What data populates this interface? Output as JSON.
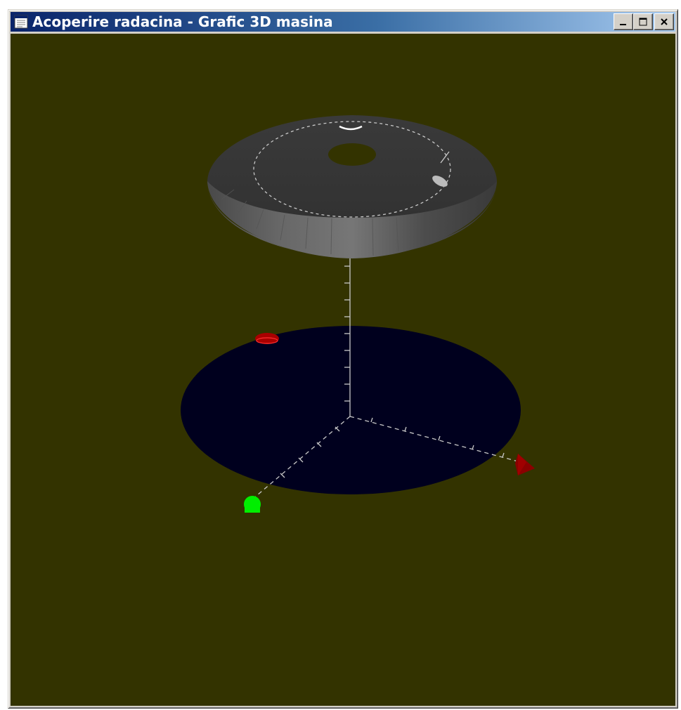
{
  "window": {
    "title": "Acoperire radacina - Grafic 3D masina",
    "app_icon": "window-app-icon",
    "buttons": [
      {
        "name": "minimize",
        "icon": "minimize-icon"
      },
      {
        "name": "maximize",
        "icon": "maximize-icon"
      },
      {
        "name": "close",
        "icon": "close-icon"
      }
    ]
  },
  "scene": {
    "background_color": "#333300",
    "disc_color": "#00001e",
    "cone_color": "#3a3a3a",
    "x_axis_marker_color": "#8b0000",
    "y_axis_marker_color": "#00ee00",
    "top_marker_color": "#aa0000",
    "axis_color": "#c8c8c8"
  }
}
